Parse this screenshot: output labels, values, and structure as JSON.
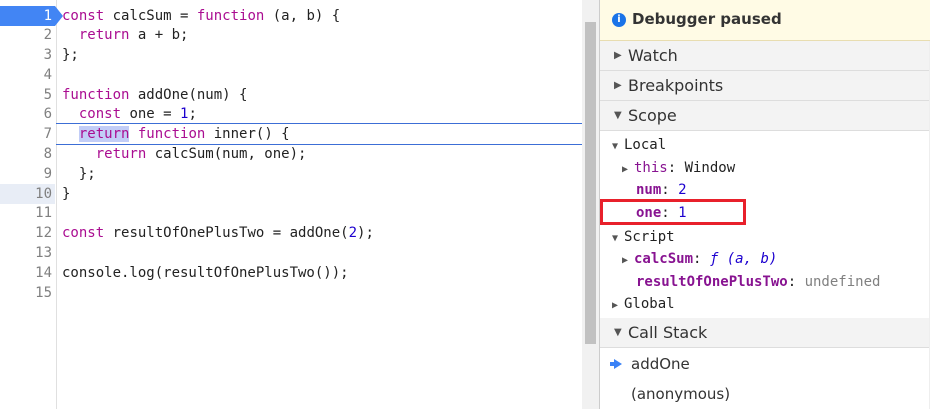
{
  "editor": {
    "gutter": [
      "1",
      "2",
      "3",
      "4",
      "5",
      "6",
      "7",
      "8",
      "9",
      "10",
      "11",
      "12",
      "13",
      "14",
      "15"
    ],
    "lines": [
      [
        {
          "t": "const calcSum = ",
          "c": "kwmix"
        }
      ],
      [],
      [],
      [],
      [],
      [],
      [],
      [],
      [],
      [],
      [],
      [],
      [],
      [],
      []
    ],
    "code": {
      "l1_kw": "const",
      "l1_rest": " calcSum = ",
      "l1_kw2": "function",
      "l1_end": " (a, b) {",
      "l2_kw": "return",
      "l2_rest": " a + b;",
      "l3": "};",
      "l5_kw": "function",
      "l5_rest": " addOne(num) {",
      "l6_kw": "const",
      "l6_rest": " one = ",
      "l6_num": "1",
      "l6_end": ";",
      "l7_kw": "return",
      "l7_kw2": "function",
      "l7_rest": " inner() {",
      "l8_kw": "return",
      "l8_rest": " calcSum(num, one);",
      "l9": "};",
      "l10": "}",
      "l12_kw": "const",
      "l12_rest": " resultOfOnePlusTwo = addOne(",
      "l12_num": "2",
      "l12_end": ");",
      "l14": "console.log(resultOfOnePlusTwo());"
    }
  },
  "debugger": {
    "paused_label": "Debugger paused",
    "info_glyph": "i",
    "sections": {
      "watch": "Watch",
      "breakpoints": "Breakpoints",
      "scope": "Scope",
      "call_stack": "Call Stack"
    },
    "scope": {
      "local_label": "Local",
      "this_name": "this",
      "this_value": "Window",
      "num_name": "num",
      "num_value": "2",
      "one_name": "one",
      "one_value": "1",
      "script_label": "Script",
      "calcsum_name": "calcSum",
      "calcsum_value": "ƒ (a, b)",
      "result_name": "resultOfOnePlusTwo",
      "result_value": "undefined",
      "global_label": "Global"
    },
    "call_stack": [
      "addOne",
      "(anonymous)"
    ],
    "colors": {
      "accent": "#4285f4",
      "highlight_box": "#e8202b",
      "paused_bg": "#fffbe5"
    }
  }
}
